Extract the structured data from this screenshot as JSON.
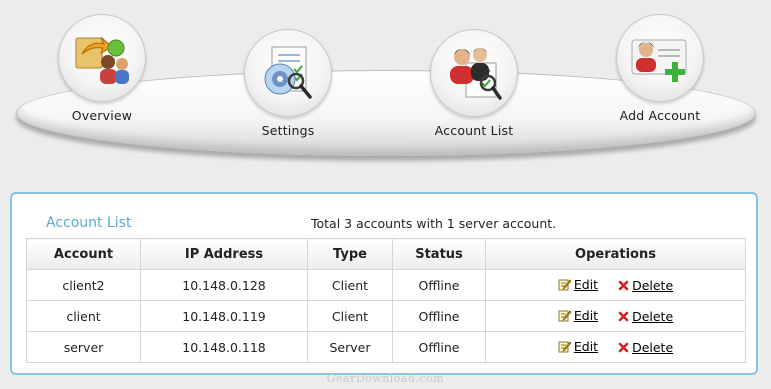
{
  "nav": {
    "items": [
      {
        "label": "Overview",
        "icon": "overview-icon"
      },
      {
        "label": "Settings",
        "icon": "settings-icon"
      },
      {
        "label": "Account List",
        "icon": "account-list-icon"
      },
      {
        "label": "Add Account",
        "icon": "add-account-icon"
      }
    ]
  },
  "panel": {
    "title": "Account List",
    "summary": "Total 3 accounts with 1 server account.",
    "columns": [
      "Account",
      "IP Address",
      "Type",
      "Status",
      "Operations"
    ],
    "rows": [
      {
        "account": "client2",
        "ip": "10.148.0.128",
        "type": "Client",
        "status": "Offline"
      },
      {
        "account": "client",
        "ip": "10.148.0.119",
        "type": "Client",
        "status": "Offline"
      },
      {
        "account": "server",
        "ip": "10.148.0.118",
        "type": "Server",
        "status": "Offline"
      }
    ],
    "edit_label": "Edit",
    "delete_label": "Delete"
  },
  "watermark": "GearDownload.com",
  "colors": {
    "accent": "#5ba9d6",
    "panel_border": "#86c3e3",
    "delete_red": "#d42020"
  }
}
